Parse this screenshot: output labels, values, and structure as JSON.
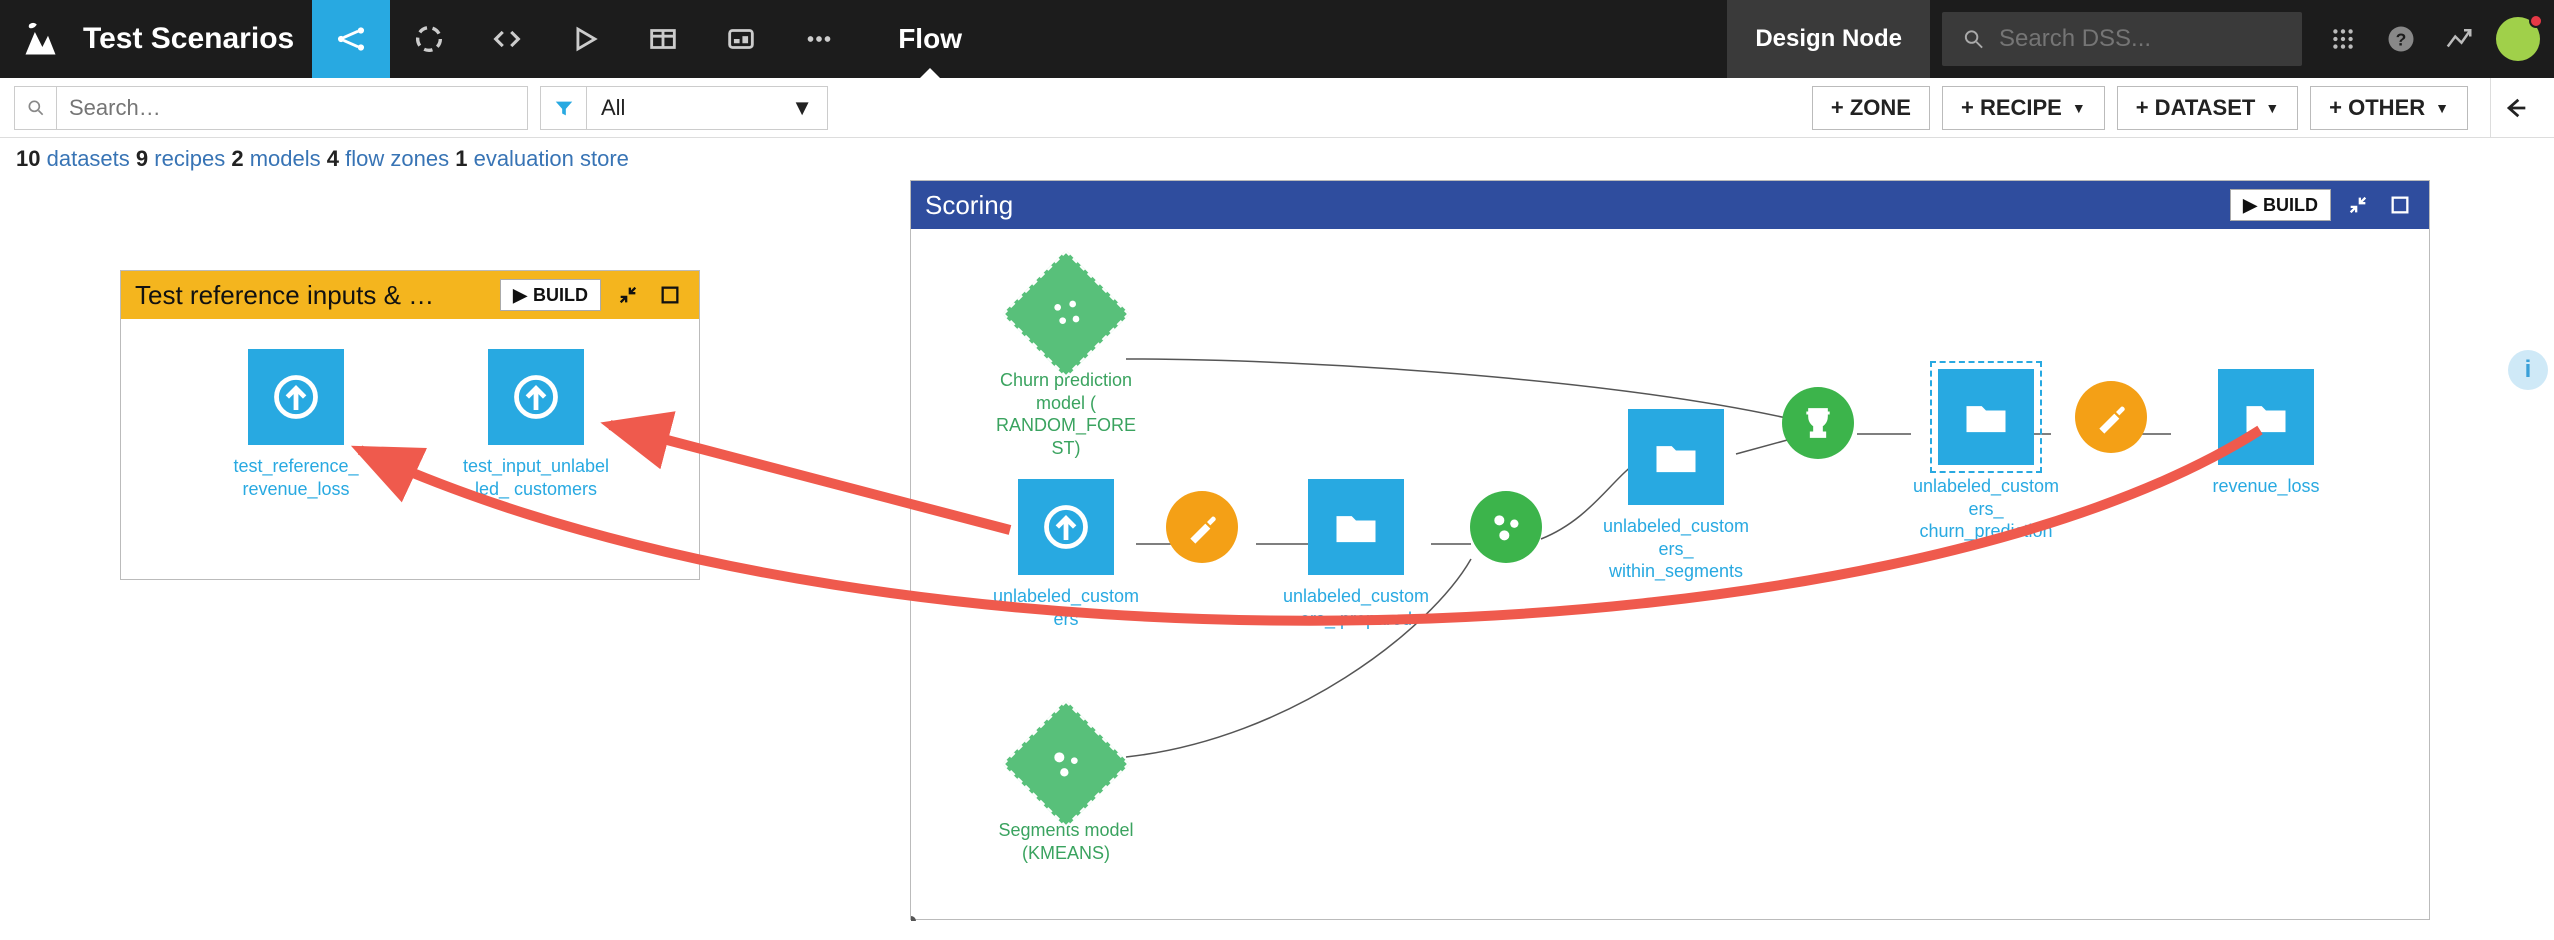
{
  "topnav": {
    "project_name": "Test Scenarios",
    "flow_label": "Flow",
    "design_node": "Design Node",
    "search_placeholder": "Search DSS..."
  },
  "toolbar": {
    "search_placeholder": "Search…",
    "filter_value": "All",
    "add_buttons": {
      "zone": "+ ZONE",
      "recipe": "+ RECIPE",
      "dataset": "+ DATASET",
      "other": "+ OTHER"
    }
  },
  "stats": {
    "datasets_n": "10",
    "datasets": "datasets",
    "recipes_n": "9",
    "recipes": "recipes",
    "models_n": "2",
    "models": "models",
    "flowzones_n": "4",
    "flowzones": "flow zones",
    "evalstore_n": "1",
    "evalstore": "evaluation store"
  },
  "zones": {
    "left": {
      "title": "Test reference inputs & …",
      "build": "BUILD",
      "nodes": {
        "n1": "test_reference_ revenue_loss",
        "n2": "test_input_unlabelled_ customers"
      }
    },
    "right": {
      "title": "Scoring",
      "build": "BUILD",
      "nodes": {
        "m1": "Churn prediction model ( RANDOM_FOREST)",
        "m2": "Segments model (KMEANS)",
        "d1": "unlabeled_customers",
        "d2": "unlabeled_customers_ prepared",
        "d3": "unlabeled_customers_ within_segments",
        "d4": "unlabeled_customers_ churn_prediction",
        "d5": "revenue_loss"
      }
    }
  }
}
